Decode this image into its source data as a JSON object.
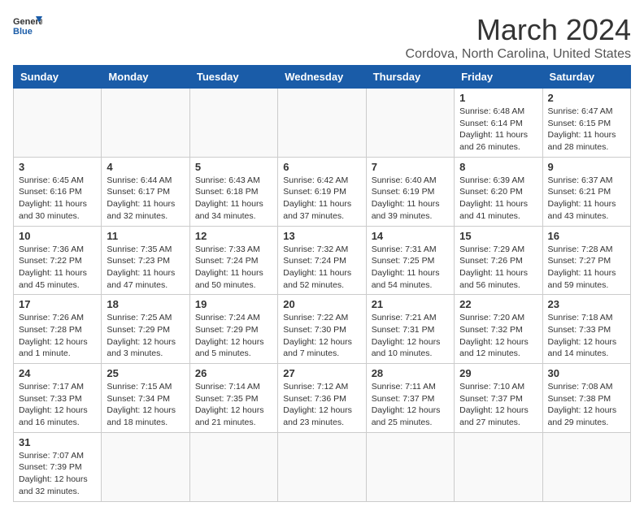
{
  "header": {
    "logo_general": "General",
    "logo_blue": "Blue",
    "month_title": "March 2024",
    "location": "Cordova, North Carolina, United States"
  },
  "weekdays": [
    "Sunday",
    "Monday",
    "Tuesday",
    "Wednesday",
    "Thursday",
    "Friday",
    "Saturday"
  ],
  "weeks": [
    [
      {
        "day": "",
        "info": ""
      },
      {
        "day": "",
        "info": ""
      },
      {
        "day": "",
        "info": ""
      },
      {
        "day": "",
        "info": ""
      },
      {
        "day": "",
        "info": ""
      },
      {
        "day": "1",
        "info": "Sunrise: 6:48 AM\nSunset: 6:14 PM\nDaylight: 11 hours and 26 minutes."
      },
      {
        "day": "2",
        "info": "Sunrise: 6:47 AM\nSunset: 6:15 PM\nDaylight: 11 hours and 28 minutes."
      }
    ],
    [
      {
        "day": "3",
        "info": "Sunrise: 6:45 AM\nSunset: 6:16 PM\nDaylight: 11 hours and 30 minutes."
      },
      {
        "day": "4",
        "info": "Sunrise: 6:44 AM\nSunset: 6:17 PM\nDaylight: 11 hours and 32 minutes."
      },
      {
        "day": "5",
        "info": "Sunrise: 6:43 AM\nSunset: 6:18 PM\nDaylight: 11 hours and 34 minutes."
      },
      {
        "day": "6",
        "info": "Sunrise: 6:42 AM\nSunset: 6:19 PM\nDaylight: 11 hours and 37 minutes."
      },
      {
        "day": "7",
        "info": "Sunrise: 6:40 AM\nSunset: 6:19 PM\nDaylight: 11 hours and 39 minutes."
      },
      {
        "day": "8",
        "info": "Sunrise: 6:39 AM\nSunset: 6:20 PM\nDaylight: 11 hours and 41 minutes."
      },
      {
        "day": "9",
        "info": "Sunrise: 6:37 AM\nSunset: 6:21 PM\nDaylight: 11 hours and 43 minutes."
      }
    ],
    [
      {
        "day": "10",
        "info": "Sunrise: 7:36 AM\nSunset: 7:22 PM\nDaylight: 11 hours and 45 minutes."
      },
      {
        "day": "11",
        "info": "Sunrise: 7:35 AM\nSunset: 7:23 PM\nDaylight: 11 hours and 47 minutes."
      },
      {
        "day": "12",
        "info": "Sunrise: 7:33 AM\nSunset: 7:24 PM\nDaylight: 11 hours and 50 minutes."
      },
      {
        "day": "13",
        "info": "Sunrise: 7:32 AM\nSunset: 7:24 PM\nDaylight: 11 hours and 52 minutes."
      },
      {
        "day": "14",
        "info": "Sunrise: 7:31 AM\nSunset: 7:25 PM\nDaylight: 11 hours and 54 minutes."
      },
      {
        "day": "15",
        "info": "Sunrise: 7:29 AM\nSunset: 7:26 PM\nDaylight: 11 hours and 56 minutes."
      },
      {
        "day": "16",
        "info": "Sunrise: 7:28 AM\nSunset: 7:27 PM\nDaylight: 11 hours and 59 minutes."
      }
    ],
    [
      {
        "day": "17",
        "info": "Sunrise: 7:26 AM\nSunset: 7:28 PM\nDaylight: 12 hours and 1 minute."
      },
      {
        "day": "18",
        "info": "Sunrise: 7:25 AM\nSunset: 7:29 PM\nDaylight: 12 hours and 3 minutes."
      },
      {
        "day": "19",
        "info": "Sunrise: 7:24 AM\nSunset: 7:29 PM\nDaylight: 12 hours and 5 minutes."
      },
      {
        "day": "20",
        "info": "Sunrise: 7:22 AM\nSunset: 7:30 PM\nDaylight: 12 hours and 7 minutes."
      },
      {
        "day": "21",
        "info": "Sunrise: 7:21 AM\nSunset: 7:31 PM\nDaylight: 12 hours and 10 minutes."
      },
      {
        "day": "22",
        "info": "Sunrise: 7:20 AM\nSunset: 7:32 PM\nDaylight: 12 hours and 12 minutes."
      },
      {
        "day": "23",
        "info": "Sunrise: 7:18 AM\nSunset: 7:33 PM\nDaylight: 12 hours and 14 minutes."
      }
    ],
    [
      {
        "day": "24",
        "info": "Sunrise: 7:17 AM\nSunset: 7:33 PM\nDaylight: 12 hours and 16 minutes."
      },
      {
        "day": "25",
        "info": "Sunrise: 7:15 AM\nSunset: 7:34 PM\nDaylight: 12 hours and 18 minutes."
      },
      {
        "day": "26",
        "info": "Sunrise: 7:14 AM\nSunset: 7:35 PM\nDaylight: 12 hours and 21 minutes."
      },
      {
        "day": "27",
        "info": "Sunrise: 7:12 AM\nSunset: 7:36 PM\nDaylight: 12 hours and 23 minutes."
      },
      {
        "day": "28",
        "info": "Sunrise: 7:11 AM\nSunset: 7:37 PM\nDaylight: 12 hours and 25 minutes."
      },
      {
        "day": "29",
        "info": "Sunrise: 7:10 AM\nSunset: 7:37 PM\nDaylight: 12 hours and 27 minutes."
      },
      {
        "day": "30",
        "info": "Sunrise: 7:08 AM\nSunset: 7:38 PM\nDaylight: 12 hours and 29 minutes."
      }
    ],
    [
      {
        "day": "31",
        "info": "Sunrise: 7:07 AM\nSunset: 7:39 PM\nDaylight: 12 hours and 32 minutes."
      },
      {
        "day": "",
        "info": ""
      },
      {
        "day": "",
        "info": ""
      },
      {
        "day": "",
        "info": ""
      },
      {
        "day": "",
        "info": ""
      },
      {
        "day": "",
        "info": ""
      },
      {
        "day": "",
        "info": ""
      }
    ]
  ]
}
